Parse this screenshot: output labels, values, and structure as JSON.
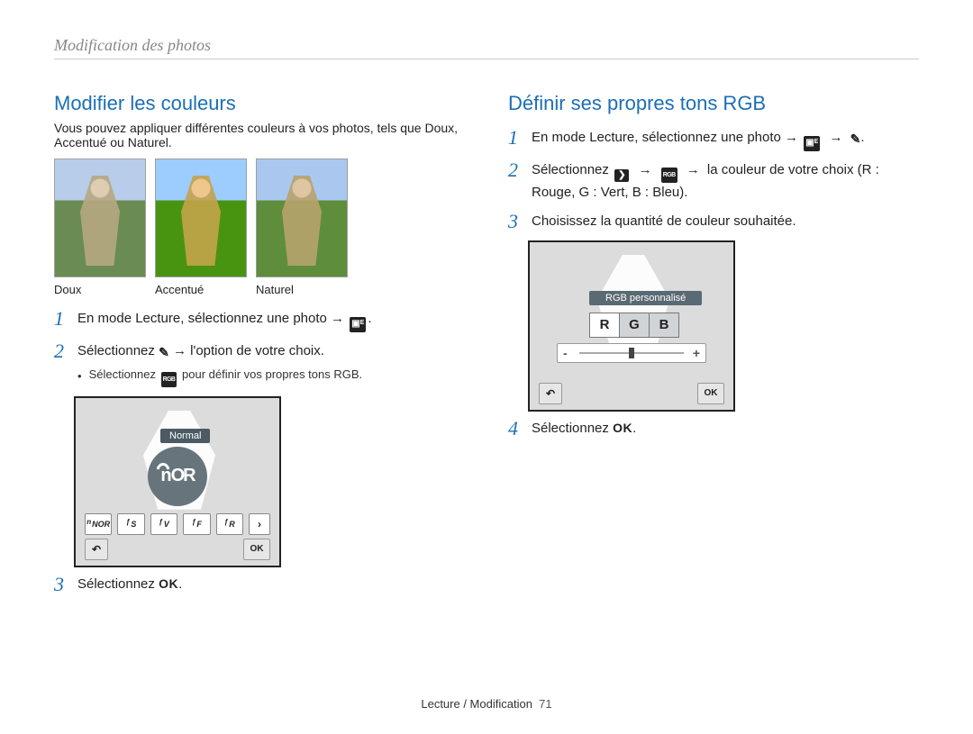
{
  "section_top": "Modification des photos",
  "footer": {
    "section": "Lecture / Modification",
    "page": "71"
  },
  "left": {
    "title": "Modifier les couleurs",
    "intro": "Vous pouvez appliquer différentes couleurs à vos photos, tels que Doux, Accentué ou Naturel.",
    "thumbs": [
      "Doux",
      "Accentué",
      "Naturel"
    ],
    "steps": [
      {
        "n": "1",
        "text": "En mode Lecture, sélectionnez une photo →",
        "tail_icon": "edit-overlay-icon",
        "period": "."
      },
      {
        "n": "2",
        "text_pre": "Sélectionnez ",
        "icon1": "brush-icon",
        "text_mid": " → l'option de votre choix.",
        "bullet_pre": "Sélectionnez ",
        "bullet_icon": "rgb-icon",
        "bullet_post": " pour définir vos propres tons RGB."
      },
      {
        "n": "3",
        "text_pre": "Sélectionnez ",
        "ok": "OK",
        "period": "."
      }
    ],
    "screen": {
      "tag": "Normal",
      "big": "NOR",
      "opts": [
        "NOR",
        "S",
        "V",
        "F",
        "R"
      ],
      "back": "↶",
      "ok": "OK"
    }
  },
  "right": {
    "title": "Définir ses propres tons RGB",
    "steps": [
      {
        "n": "1",
        "text": "En mode Lecture, sélectionnez une photo →",
        "icon1": "edit-overlay-icon",
        "arrow": "→",
        "icon2": "brush-icon",
        "period": "."
      },
      {
        "n": "2",
        "text_pre": "Sélectionnez ",
        "icon1": "chevron-right-icon",
        "arrow1": "→",
        "icon2": "rgb-icon",
        "arrow2": "→",
        "text_post": "la couleur de votre choix (R : Rouge, G : Vert, B : Bleu)."
      },
      {
        "n": "3",
        "text": "Choisissez la quantité de couleur souhaitée."
      },
      {
        "n": "4",
        "text_pre": "Sélectionnez ",
        "ok": "OK",
        "period": "."
      }
    ],
    "screen": {
      "tag": "RGB personnalisé",
      "rgb": [
        "R",
        "G",
        "B"
      ],
      "minus": "-",
      "plus": "+",
      "back": "↶",
      "ok": "OK"
    }
  }
}
